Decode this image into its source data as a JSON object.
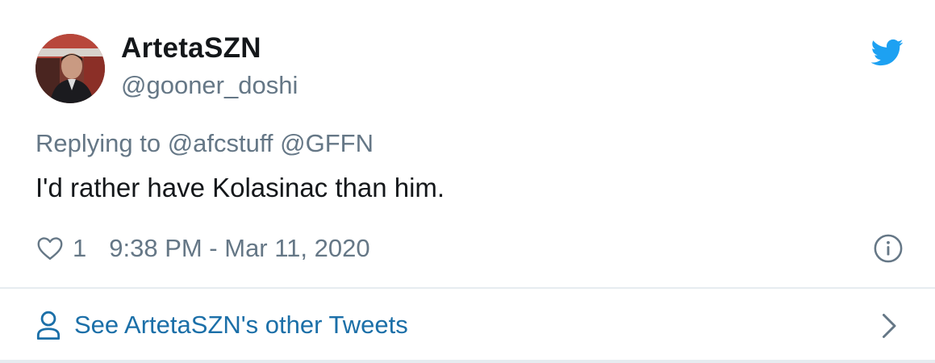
{
  "tweet": {
    "display_name": "ArtetaSZN",
    "handle": "@gooner_doshi",
    "replying_to": "Replying to @afcstuff @GFFN",
    "text": "I'd rather have Kolasinac than him.",
    "like_count": "1",
    "timestamp": "9:38 PM - Mar 11, 2020"
  },
  "footer": {
    "link_label": "See ArtetaSZN's other Tweets"
  },
  "icons": {
    "brand": "twitter-bird-icon",
    "like": "heart-icon",
    "info": "info-icon",
    "profile": "person-icon",
    "next": "chevron-right-icon"
  },
  "colors": {
    "brand_blue": "#1da1f2",
    "link_blue": "#1b6fa8",
    "secondary_text": "#657786",
    "primary_text": "#14171a",
    "divider": "#e6ecf0"
  }
}
